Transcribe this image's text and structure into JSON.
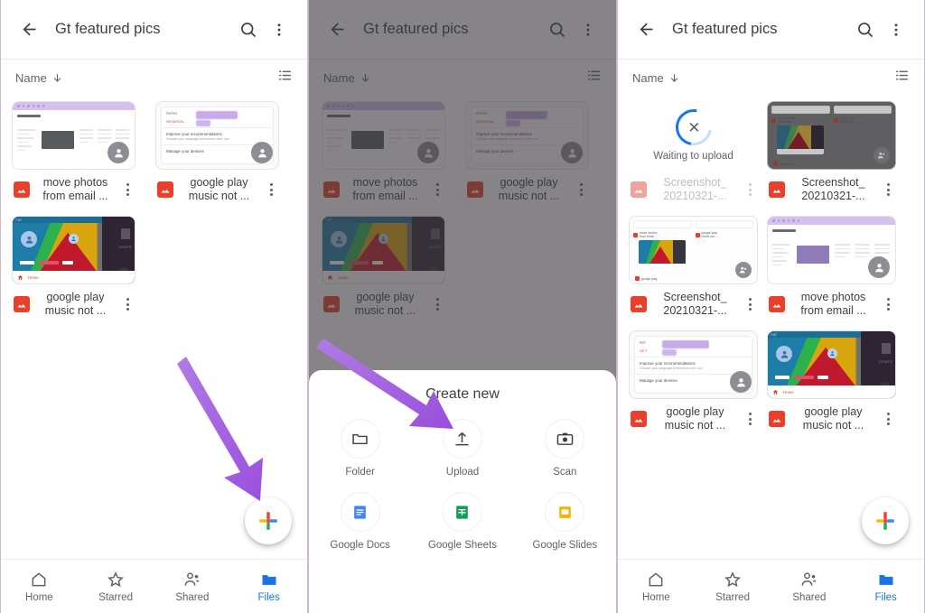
{
  "app": {
    "title": "Gt featured pics",
    "sort_label": "Name",
    "sort_direction_icon": "arrow-down-icon",
    "search_icon": "search-icon",
    "overflow_icon": "more-vert-icon",
    "back_icon": "back-arrow-icon",
    "list_view_icon": "list-view-icon",
    "fab_icon": "plus-icon",
    "accent_blue": "#1a73e8",
    "arrow_purple": "#a764e0"
  },
  "bottom_nav": {
    "items": [
      {
        "label": "Home",
        "icon": "home-icon",
        "active": false
      },
      {
        "label": "Starred",
        "icon": "star-icon",
        "active": false
      },
      {
        "label": "Shared",
        "icon": "people-icon",
        "active": false
      },
      {
        "label": "Files",
        "icon": "folder-icon",
        "active": true
      }
    ]
  },
  "panel_left": {
    "files": [
      {
        "name": "move photos\nfrom email ...",
        "thumb": "browser-screenshot",
        "ghost": false
      },
      {
        "name": "google play\nmusic not ...",
        "thumb": "settings-card",
        "ghost": false
      },
      {
        "name": "google play\nmusic not ...",
        "thumb": "colorful-geometry",
        "ghost": false
      }
    ]
  },
  "panel_mid": {
    "files": [
      {
        "name": "move photos\nfrom email ...",
        "thumb": "browser-screenshot",
        "ghost": false
      },
      {
        "name": "google play\nmusic not ...",
        "thumb": "settings-card",
        "ghost": false
      },
      {
        "name": "google play\nmusic not ...",
        "thumb": "colorful-geometry",
        "ghost": false
      }
    ],
    "sheet": {
      "title": "Create new",
      "items": [
        {
          "label": "Folder",
          "icon": "folder-outline-icon"
        },
        {
          "label": "Upload",
          "icon": "upload-icon"
        },
        {
          "label": "Scan",
          "icon": "camera-icon"
        },
        {
          "label": "Google Docs",
          "icon": "google-docs-icon"
        },
        {
          "label": "Google Sheets",
          "icon": "google-sheets-icon"
        },
        {
          "label": "Google Slides",
          "icon": "google-slides-icon"
        }
      ]
    }
  },
  "panel_right": {
    "upload_status": "Waiting to upload",
    "files": [
      {
        "name": "Screenshot_\n20210321-...",
        "thumb": "uploading",
        "ghost": true
      },
      {
        "name": "Screenshot_\n20210321-...",
        "thumb": "drive-nested-dark",
        "ghost": false
      },
      {
        "name": "Screenshot_\n20210321-...",
        "thumb": "drive-nested",
        "ghost": false
      },
      {
        "name": "move photos\nfrom email ...",
        "thumb": "browser-screenshot",
        "ghost": false
      },
      {
        "name": "google play\nmusic not ...",
        "thumb": "settings-card",
        "ghost": false
      },
      {
        "name": "google play\nmusic not ...",
        "thumb": "colorful-geometry",
        "ghost": false
      }
    ]
  }
}
